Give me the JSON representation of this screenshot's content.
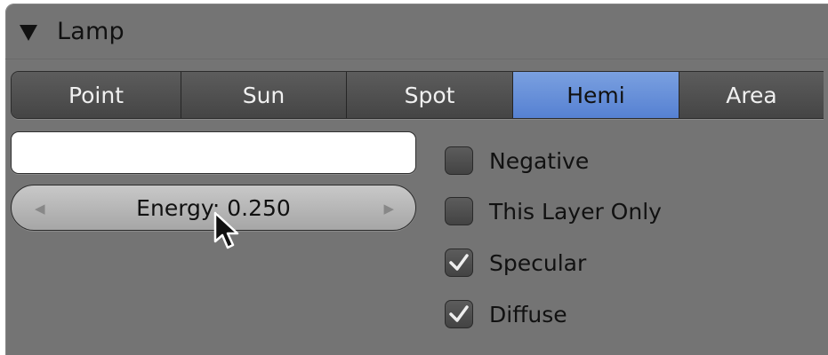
{
  "panel": {
    "title": "Lamp"
  },
  "lamp_types": [
    {
      "label": "Point",
      "active": false
    },
    {
      "label": "Sun",
      "active": false
    },
    {
      "label": "Spot",
      "active": false
    },
    {
      "label": "Hemi",
      "active": true
    },
    {
      "label": "Area",
      "active": false
    }
  ],
  "color": {
    "value": "#ffffff"
  },
  "energy": {
    "label": "Energy: 0.250",
    "value": 0.25
  },
  "options": [
    {
      "label": "Negative",
      "checked": false
    },
    {
      "label": "This Layer Only",
      "checked": false
    },
    {
      "label": "Specular",
      "checked": true
    },
    {
      "label": "Diffuse",
      "checked": true
    }
  ],
  "colors": {
    "panel_bg": "#747474",
    "tab_active": "#5681d2",
    "tab_inactive": "#4f4f4f"
  }
}
